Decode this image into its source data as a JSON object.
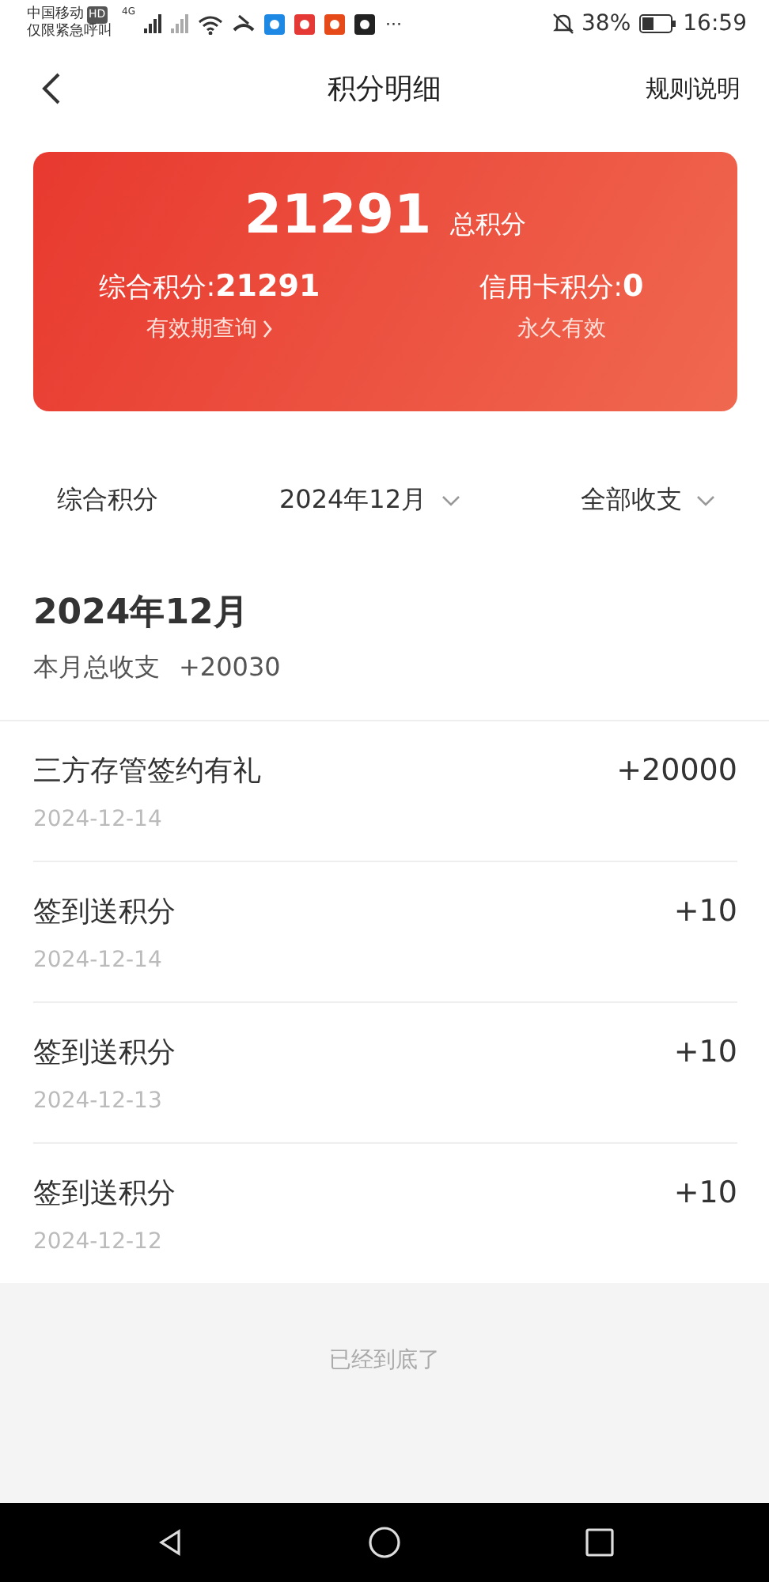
{
  "status_bar": {
    "carrier": "中国移动",
    "carrier_badge": "HD",
    "emergency": "仅限紧急呼叫",
    "network": "4G",
    "more": "···",
    "battery": "38%",
    "time": "16:59"
  },
  "header": {
    "title": "积分明细",
    "rules_link": "规则说明"
  },
  "card": {
    "total": "21291",
    "total_label": "总积分",
    "combined_label": "综合积分:",
    "combined": "21291",
    "validity_link": "有效期查询",
    "credit_label": "信用卡积分:",
    "credit": "0",
    "credit_note": "永久有效"
  },
  "filters": [
    {
      "label": "综合积分",
      "has_dropdown": false
    },
    {
      "label": "2024年12月",
      "has_dropdown": true
    },
    {
      "label": "全部收支",
      "has_dropdown": true
    }
  ],
  "month": {
    "title": "2024年12月",
    "summary_label": "本月总收支",
    "summary_value": "+20030"
  },
  "records": [
    {
      "title": "三方存管签约有礼",
      "date": "2024-12-14",
      "amount": "+20000"
    },
    {
      "title": "签到送积分",
      "date": "2024-12-14",
      "amount": "+10"
    },
    {
      "title": "签到送积分",
      "date": "2024-12-13",
      "amount": "+10"
    },
    {
      "title": "签到送积分",
      "date": "2024-12-12",
      "amount": "+10"
    }
  ],
  "footer": {
    "text": "已经到底了"
  }
}
